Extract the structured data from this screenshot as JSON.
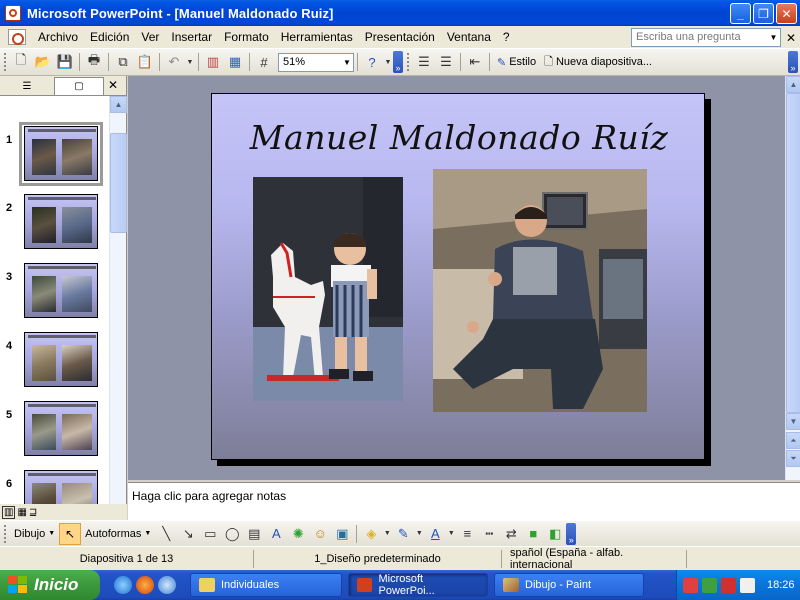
{
  "window": {
    "title": "Microsoft PowerPoint - [Manuel Maldonado Ruiz]",
    "min_label": "_",
    "max_label": "❐",
    "close_label": "✕"
  },
  "menu": {
    "items": [
      {
        "label": "Archivo"
      },
      {
        "label": "Edición"
      },
      {
        "label": "Ver"
      },
      {
        "label": "Insertar"
      },
      {
        "label": "Formato"
      },
      {
        "label": "Herramientas"
      },
      {
        "label": "Presentación"
      },
      {
        "label": "Ventana"
      },
      {
        "label": "?"
      }
    ],
    "ask_placeholder": "Escriba una pregunta",
    "close_label": "✕"
  },
  "toolbar": {
    "zoom": "51%",
    "style_label": "Estilo",
    "new_slide_label": "Nueva diapositiva..."
  },
  "left_panel": {
    "close_label": "✕",
    "slides": [
      {
        "number": "1"
      },
      {
        "number": "2"
      },
      {
        "number": "3"
      },
      {
        "number": "4"
      },
      {
        "number": "5"
      },
      {
        "number": "6"
      }
    ]
  },
  "slide": {
    "title": "Manuel Maldonado Ruíz"
  },
  "notes": {
    "placeholder": "Haga clic para agregar notas"
  },
  "drawbar": {
    "dibujo_label": "Dibujo",
    "autoformas_label": "Autoformas"
  },
  "status": {
    "slide_pos": "Diapositiva 1 de 13",
    "design": "1_Diseño predeterminado",
    "language": "spañol (España - alfab. internacional"
  },
  "taskbar": {
    "start_label": "Inicio",
    "tasks": [
      {
        "label": "Individuales"
      },
      {
        "label": "Microsoft PowerPoi..."
      },
      {
        "label": "Dibujo - Paint"
      }
    ],
    "clock": "18:26"
  },
  "colors": {
    "titlebar": "#0055E5",
    "slide_top": "#C4C4F8",
    "slide_bottom": "#7E7E98",
    "taskbar": "#245EDC",
    "start_green": "#3C983C"
  }
}
